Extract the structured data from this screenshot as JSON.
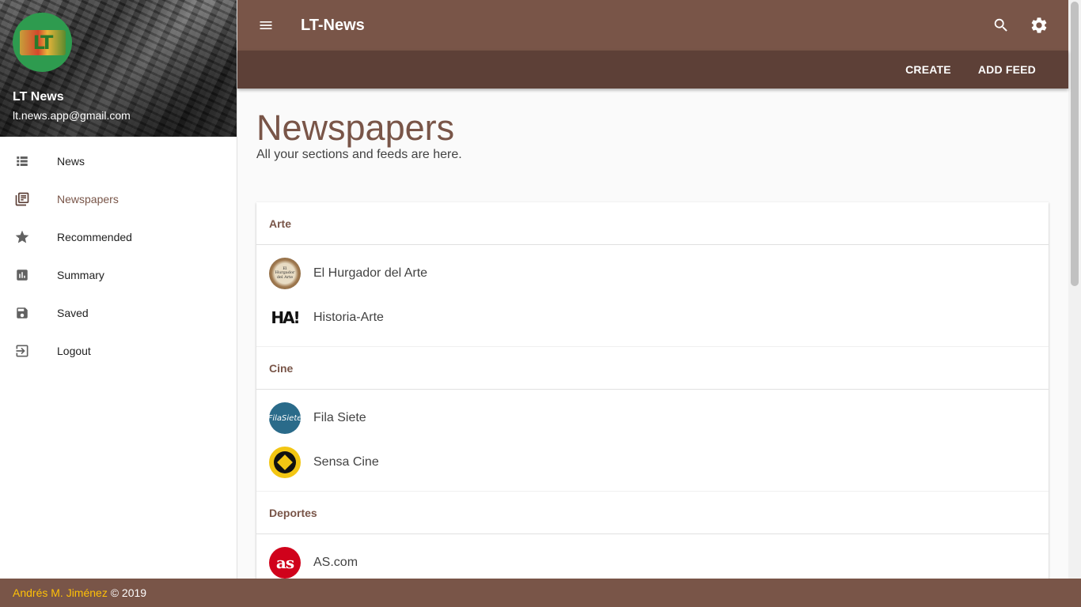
{
  "drawer": {
    "user_name": "LT News",
    "user_email": "lt.news.app@gmail.com",
    "logo_text": "LT",
    "items": [
      {
        "label": "News",
        "icon": "list-icon",
        "active": false
      },
      {
        "label": "Newspapers",
        "icon": "newspaper-icon",
        "active": true
      },
      {
        "label": "Recommended",
        "icon": "star-icon",
        "active": false
      },
      {
        "label": "Summary",
        "icon": "bar-chart-icon",
        "active": false
      },
      {
        "label": "Saved",
        "icon": "save-icon",
        "active": false
      },
      {
        "label": "Logout",
        "icon": "logout-icon",
        "active": false
      }
    ]
  },
  "appbar": {
    "title": "LT-News",
    "actions": [
      "search-icon",
      "settings-icon"
    ]
  },
  "toolbar": {
    "create_label": "CREATE",
    "add_feed_label": "ADD FEED"
  },
  "main": {
    "title": "Newspapers",
    "subtitle": "All your sections and feeds are here.",
    "sections": [
      {
        "name": "Arte",
        "feeds": [
          {
            "name": "El Hurgador del Arte",
            "logo": "hurgador"
          },
          {
            "name": "Historia-Arte",
            "logo": "ha",
            "logo_text": "HA!"
          }
        ]
      },
      {
        "name": "Cine",
        "feeds": [
          {
            "name": "Fila Siete",
            "logo": "fila",
            "logo_text": "FilaSiete"
          },
          {
            "name": "Sensa Cine",
            "logo": "sensa"
          }
        ]
      },
      {
        "name": "Deportes",
        "feeds": [
          {
            "name": "AS.com",
            "logo": "as",
            "logo_text": "as"
          }
        ]
      }
    ]
  },
  "footer": {
    "author": "Andrés M. Jiménez",
    "copyright": " © 2019"
  },
  "colors": {
    "primary": "#795548",
    "primary_dark": "#5d4037",
    "accent": "#ffc107"
  }
}
